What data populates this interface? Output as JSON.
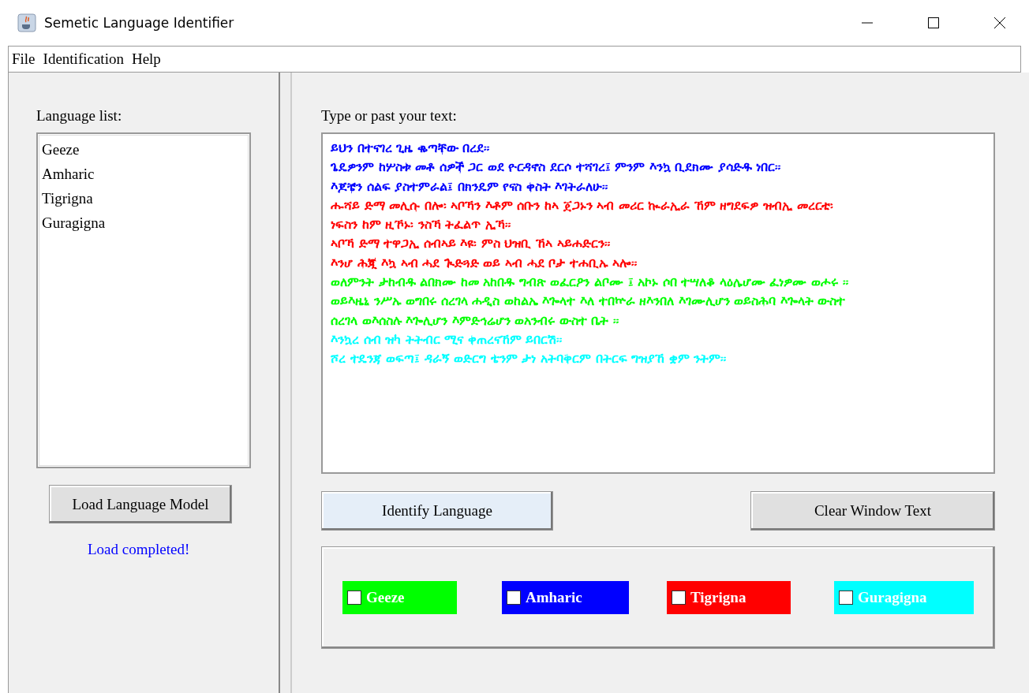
{
  "window": {
    "title": "Semetic Language Identifier"
  },
  "menu": [
    "File",
    "Identification",
    "Help"
  ],
  "language_list": {
    "label": "Language list:",
    "items": [
      "Geeze",
      "Amharic",
      "Tigrigna",
      "Guragigna"
    ]
  },
  "load_button": "Load Language Model",
  "status": "Load completed!",
  "input": {
    "label": "Type or past your text:",
    "lines": [
      {
        "text": "ይህን በተናገረ ጊዜ ቈጣቸው በረደ።",
        "color": "#0000ff"
      },
      {
        "text": "ጌዴዎንም ከሦስቱ መቶ ሰዎች ጋር ወደ ዮርዳኖስ ደርሶ ተሻገረ፤ ምንም እንኳ ቢደክሙ ያሳድዱ ነበር።",
        "color": "#0000ff"
      },
      {
        "text": "እጆቼን ሰልፍ ያስተምራል፤ በክንዴም የናስ ቀስት እገትራለሁ።",
        "color": "#0000ff"
      },
      {
        "text": "ሑሻይ ድማ መሊሱ በሎ፡ ኣቦኻን እቶም ሰቡን ከኣ ጀጋኑን ኣብ መሪር ኲራኢራ ኸም ዘግደፍዎ ዝብኢ መረርቲ፡",
        "color": "#ff0000"
      },
      {
        "text": "ነፍስን ከም ዚኾኑ፡ ንስኻ ትፈልጥ ኢኻ።",
        "color": "#ff0000"
      },
      {
        "text": "ኣቦኻ ድማ ተዋጋኢ ሰብኣይ እዩ፡ ምስ ህዝቢ ኸኣ ኣይሐድርን።",
        "color": "#ff0000"
      },
      {
        "text": "እንሆ ሕጂ እኳ ኣብ ሓደ ጒድጓድ ወይ ኣብ ሓደ ቦታ ተሐቢኡ ኣሎ።",
        "color": "#ff0000"
      },
      {
        "text": "ወለምንት ታከብዱ ልበክሙ ከመ አከበዱ ግብጽ ወፈርዖን ልቦሙ ፤ አኮኑ ሶበ ተሣለቆ ላዕሌሆሙ ፈነዎሙ ወሖሩ ።",
        "color": "#00ff00"
      },
      {
        "text": "ወይእዜኒ ንሥኡ ወግበሩ ሰረገላ ሐዲስ ወከልኤ እጐላተ እለ ተበኵራ ዘእንበለ እገሙሊሆን ወይስሕባ እጐላት ውስተ",
        "color": "#00ff00"
      },
      {
        "text": "ሰረገላ ወእሰስሉ እጐሊሆን እምድኅሬሆን ወአንብሩ ውስተ ቤት ።",
        "color": "#00ff00"
      },
      {
        "text": "እንኳረ ሰብ ዝካ ትትብር ሚና ቀጠረናኸም ይበርሽ።",
        "color": "#00ffff"
      },
      {
        "text": "ሾረ ተዴንጃ ወፍጣ፤ ዳራኝ ወድርግ ቴንም ታነ አትባቅርም በትርፍ ግዝያኸ ቋም ንትም።",
        "color": "#00ffff"
      }
    ]
  },
  "buttons": [
    "Identify Language",
    "Clear Window Text"
  ],
  "legend": [
    {
      "label": "Geeze",
      "color": "#00ff00",
      "checked": false
    },
    {
      "label": "Amharic",
      "color": "#0000ff",
      "checked": false
    },
    {
      "label": "Tigrigna",
      "color": "#ff0000",
      "checked": false
    },
    {
      "label": "Guragigna",
      "color": "#00ffff",
      "checked": false
    }
  ]
}
